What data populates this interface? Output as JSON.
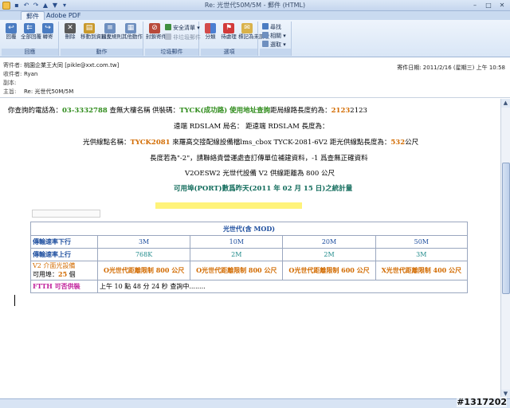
{
  "window": {
    "title": "Re: 光世代50M/5M - 郵件 (HTML)"
  },
  "tabs": [
    {
      "label": "郵件"
    },
    {
      "label": "Adobe PDF"
    }
  ],
  "ribbon": {
    "groups": [
      {
        "label": "回應",
        "buttons": [
          "回覆",
          "全部回覆",
          "轉寄"
        ]
      },
      {
        "label": "動作",
        "buttons": [
          "刪除",
          "移動到資料夾",
          "建立規則",
          "其他動作"
        ]
      },
      {
        "label": "垃圾郵件",
        "buttons": [
          "封鎖寄件者"
        ],
        "small": [
          "安全清單",
          "非垃圾郵件"
        ]
      },
      {
        "label": "選項",
        "buttons": [
          "分類",
          "待處理",
          "標記為未讀取"
        ]
      },
      {
        "label": "",
        "buttons": [],
        "small": [
          "尋找",
          "相關",
          "選取"
        ]
      }
    ]
  },
  "header": {
    "from_label": "寄件者:",
    "from": "桃園企業王大同 [pikle@xxt.com.tw]",
    "to_label": "收件者:",
    "to": "Ryan",
    "cc_label": "副本:",
    "cc": "",
    "subject_label": "主旨:",
    "subject": "Re: 光世代50M/5M",
    "sent": "寄件日期:     2011/2/16 (星期三) 上午 10:58"
  },
  "body": {
    "line1_a": "你查詢的電話為：",
    "line1_phone": "03-3332788",
    "line1_b": " 查無大樓名稱 供裝碼：",
    "line1_code": "TYCK(成功路) 使用地址查詢",
    "line1_c": "距局線路長度約為：",
    "line1_len": "2123",
    "line1_d": "2123",
    "line2": "遠端 RDSLAM 局名：   距遠端 RDSLAM 長度為：",
    "line3_a": "光供線點名稱：",
    "line3_code": "TYCK2081",
    "line3_b": " 來羅高交接配線設備檔lms_cbox TYCK-2081-6V2 距光供線點長度為：",
    "line3_len": "532",
    "line3_c": "公尺",
    "line4": "長度若為\"-2\"，請聯絡貴營運處查訂傳單位補建資料，-1 爲查無正確資料",
    "line5": "V2OESW2 光世代設備 V2 供線距離為 800 公尺",
    "line6": "可用埠(PORT)數爲昨天(2011 年 02 月 15 日)之統計量"
  },
  "table": {
    "title": "光世代(含 MOD)",
    "down_label": "傳輸速率下行",
    "down": [
      "3M",
      "10M",
      "20M",
      "50M"
    ],
    "up_label": "傳輸速率上行",
    "up": [
      "768K",
      "2M",
      "2M",
      "3M"
    ],
    "v2_label": "V2 介面光設備",
    "v2_avail_prefix": "可用埠：",
    "v2_avail": "25",
    "v2_avail_suffix": " 個",
    "v2": [
      "O光世代距離限制 800 公尺",
      "O光世代距離限制 800 公尺",
      "O光世代距離限制 600 公尺",
      "X光世代距離限制 400 公尺"
    ],
    "ftth_label": "FTTH 可否供裝",
    "ftth_value": "上午 10 點 48 分 24 秒 查詢中........"
  },
  "watermark": "#1317202"
}
